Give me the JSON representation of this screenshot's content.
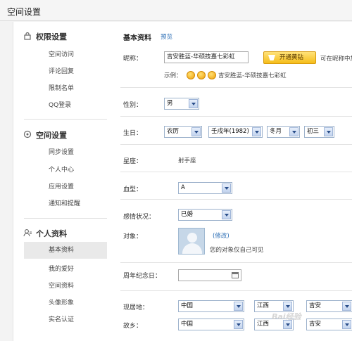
{
  "page": {
    "title": "空间设置"
  },
  "sidebar": {
    "sections": [
      {
        "title": "权限设置",
        "icon": "lock-icon",
        "items": [
          "空间访问",
          "评论回复",
          "限制名单",
          "QQ登录"
        ]
      },
      {
        "title": "空间设置",
        "icon": "settings-icon",
        "items": [
          "同步设置",
          "个人中心",
          "应用设置",
          "通知和提醒"
        ]
      },
      {
        "title": "个人资料",
        "icon": "user-icon",
        "items": [
          "基本资料",
          "我的爱好",
          "空间资料",
          "头像形象",
          "实名认证"
        ]
      }
    ],
    "active_item": "基本资料"
  },
  "form": {
    "section_title": "基本资料",
    "preview_link": "预览",
    "nickname": {
      "label": "昵称：",
      "value": "吉安胜蓝-华硕技嘉七彩虹",
      "vip_button": "开通黄钻",
      "hint": "可在昵称中加入",
      "example_label": "示例：",
      "example_text": "吉安胜蓝-华硕技嘉七彩虹"
    },
    "gender": {
      "label": "性别：",
      "value": "男"
    },
    "birthday": {
      "label": "生日：",
      "calendar": "农历",
      "year": "壬戌年(1982)",
      "month": "冬月",
      "day": "初三"
    },
    "zodiac": {
      "label": "星座：",
      "value": "射手座"
    },
    "blood": {
      "label": "血型：",
      "value": "A"
    },
    "marital": {
      "label": "感情状况：",
      "value": "已婚"
    },
    "partner": {
      "label": "对象：",
      "edit_link": "(修改)",
      "note": "您的对象仅自己可见"
    },
    "anniversary": {
      "label": "周年纪念日："
    },
    "residence": {
      "label": "现居地：",
      "country": "中国",
      "province": "江西",
      "city": "吉安"
    },
    "hometown": {
      "label": "故乡：",
      "country": "中国",
      "province": "江西",
      "city": "吉安"
    }
  },
  "watermark": "Bai经验"
}
